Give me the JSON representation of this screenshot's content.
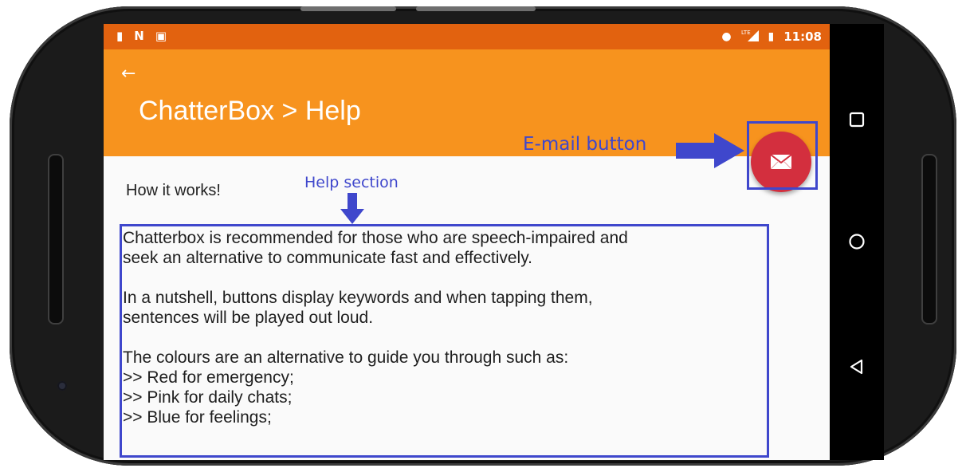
{
  "status_bar": {
    "left_icons": [
      "sd-card-icon",
      "n-icon",
      "a-icon"
    ],
    "time": "11:08",
    "network": "LTE"
  },
  "app_bar": {
    "back_icon": "back-arrow-icon",
    "title": "ChatterBox > Help"
  },
  "content": {
    "heading": "How it works!",
    "paragraph1_line1": "Chatterbox is recommended for those who are speech-impaired and",
    "paragraph1_line2": "seek an alternative to communicate fast and effectively.",
    "paragraph2_line1": "In a nutshell, buttons display keywords and when tapping them,",
    "paragraph2_line2": "sentences will be played out loud.",
    "paragraph3_line1": "The colours are an alternative to guide you through such as:",
    "paragraph3_line2": ">> Red for emergency;",
    "paragraph3_line3": ">> Pink for daily chats;",
    "paragraph3_line4": ">> Blue for feelings;"
  },
  "fab": {
    "icon": "email-icon"
  },
  "annotations": {
    "email_label": "E-mail button",
    "help_label": "Help section"
  },
  "colors": {
    "status_bar": "#e2620f",
    "app_bar": "#f7931e",
    "fab": "#d32f3e",
    "annotation": "#3f47cc"
  }
}
